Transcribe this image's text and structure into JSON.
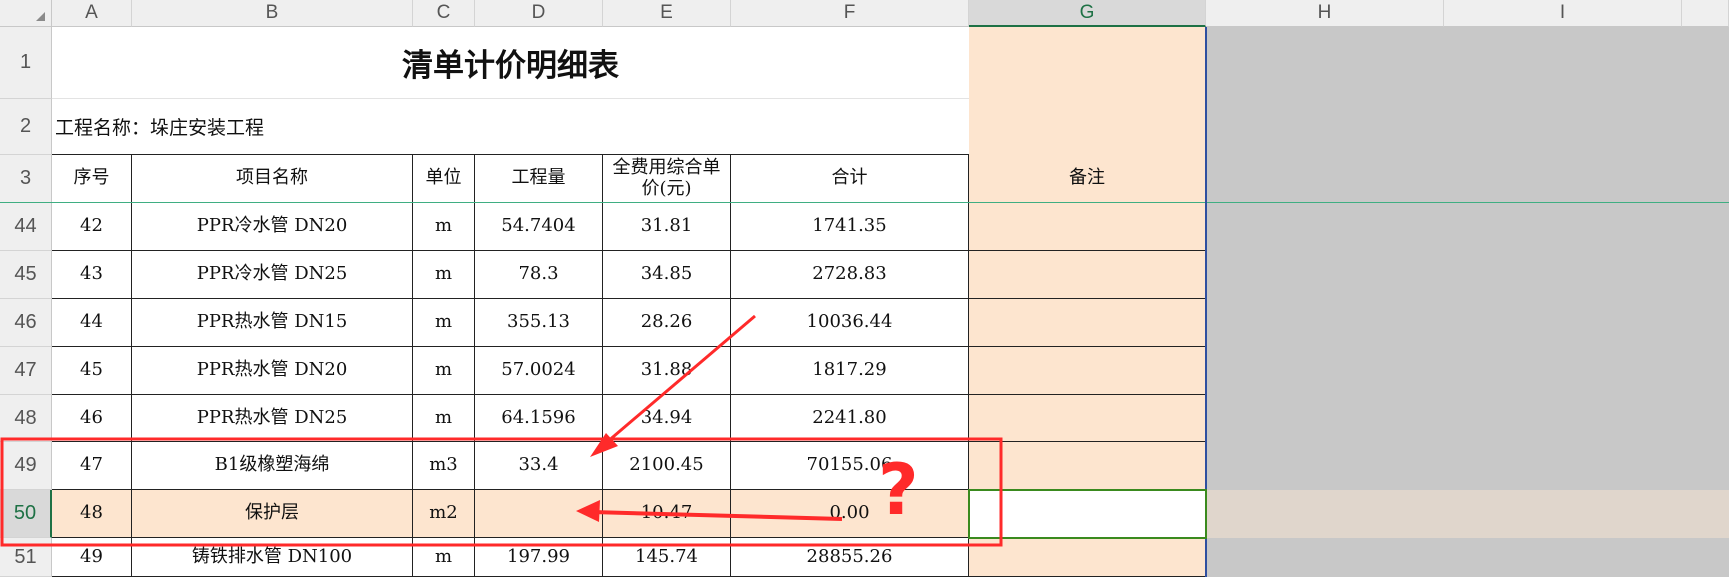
{
  "column_headers": [
    "A",
    "B",
    "C",
    "D",
    "E",
    "F",
    "G",
    "H",
    "I"
  ],
  "row_headers": [
    "1",
    "2",
    "3",
    "44",
    "45",
    "46",
    "47",
    "48",
    "49",
    "50",
    "51"
  ],
  "title": "清单计价明细表",
  "project_name": "工程名称：垛庄安装工程",
  "table": {
    "headers": [
      "序号",
      "项目名称",
      "单位",
      "工程量",
      "全费用综合单价(元)",
      "合计",
      "备注"
    ],
    "rows": [
      [
        "42",
        "PPR冷水管 DN20",
        "m",
        "54.7404",
        "31.81",
        "1741.35",
        ""
      ],
      [
        "43",
        "PPR冷水管 DN25",
        "m",
        "78.3",
        "34.85",
        "2728.83",
        ""
      ],
      [
        "44",
        "PPR热水管 DN15",
        "m",
        "355.13",
        "28.26",
        "10036.44",
        ""
      ],
      [
        "45",
        "PPR热水管 DN20",
        "m",
        "57.0024",
        "31.88",
        "1817.29",
        ""
      ],
      [
        "46",
        "PPR热水管 DN25",
        "m",
        "64.1596",
        "34.94",
        "2241.80",
        ""
      ],
      [
        "47",
        "B1级橡塑海绵",
        "m3",
        "33.4",
        "2100.45",
        "70155.06",
        ""
      ],
      [
        "48",
        "保护层",
        "m2",
        "",
        "10.47",
        "0.00",
        ""
      ],
      [
        "49",
        "铸铁排水管 DN100",
        "m",
        "197.99",
        "145.74",
        "28855.26",
        ""
      ]
    ]
  },
  "annotation": {
    "question_mark": "?"
  },
  "selected_cell": "G50",
  "colors": {
    "peach": "#fde5cf",
    "selection_green": "#1e7145",
    "annotation_red": "#ff2a2a",
    "gray_area": "#c8c8c8"
  }
}
